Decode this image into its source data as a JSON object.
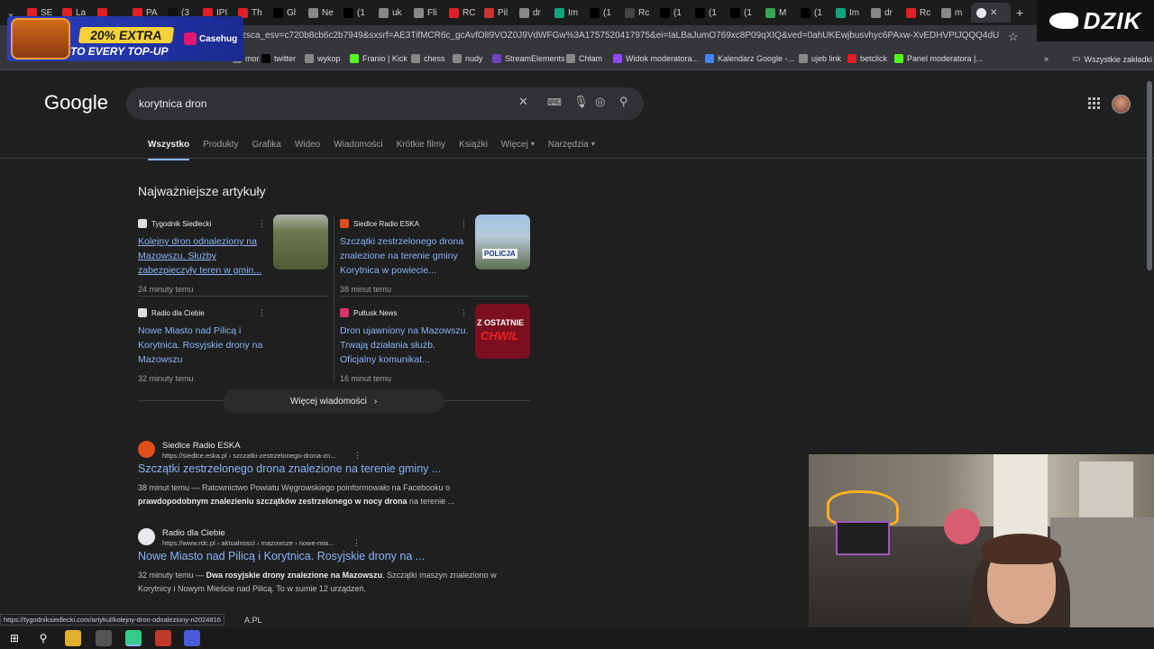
{
  "browser": {
    "tabs": [
      {
        "label": "SE",
        "color": "#e21f26"
      },
      {
        "label": "La",
        "color": "#e21f26"
      },
      {
        "label": "",
        "color": "#e21f26"
      },
      {
        "label": "PA",
        "color": "#e21f26"
      },
      {
        "label": "(3",
        "color": "#111111"
      },
      {
        "label": "IPI",
        "color": "#e21f26"
      },
      {
        "label": "Th",
        "color": "#e21f26"
      },
      {
        "label": "Gl",
        "color": "#000000"
      },
      {
        "label": "Ne",
        "color": "#888888"
      },
      {
        "label": "(1",
        "color": "#000000"
      },
      {
        "label": "uk",
        "color": "#888888"
      },
      {
        "label": "Fli",
        "color": "#888888"
      },
      {
        "label": "RC",
        "color": "#e21f26"
      },
      {
        "label": "Pil",
        "color": "#cc3333"
      },
      {
        "label": "dr",
        "color": "#888888"
      },
      {
        "label": "Im",
        "color": "#10a37f"
      },
      {
        "label": "(1",
        "color": "#000000"
      },
      {
        "label": "Rc",
        "color": "#444444"
      },
      {
        "label": "(1",
        "color": "#000000"
      },
      {
        "label": "(1",
        "color": "#000000"
      },
      {
        "label": "(1",
        "color": "#000000"
      },
      {
        "label": "M",
        "color": "#34a853"
      },
      {
        "label": "(1",
        "color": "#000000"
      },
      {
        "label": "Im",
        "color": "#10a37f"
      },
      {
        "label": "dr",
        "color": "#888888"
      },
      {
        "label": "Rc",
        "color": "#e21f26"
      },
      {
        "label": "m",
        "color": "#888888"
      }
    ],
    "active_tab_index": 27,
    "url": "zsca_esv=c720b8cb6c2b7949&sxsrf=AE3TifMCR6c_gcAvfOlI9VOZ0J9VdWFGw%3A1757520417975&ei=IaLBaJumO769xc8P09qXIQ&ved=0ahUKEwjbusvhyc6PAxw-XvEDHVPtJQQQ4dUDCBA&uact=5&oq...",
    "bookmarks": [
      {
        "label": "mor",
        "color": "#888888"
      },
      {
        "label": "twitter",
        "color": "#000000"
      },
      {
        "label": "wykop",
        "color": "#888888"
      },
      {
        "label": "Franio | Kick",
        "color": "#53fc18"
      },
      {
        "label": "chess",
        "color": "#888888"
      },
      {
        "label": "nudy",
        "color": "#888888"
      },
      {
        "label": "StreamElements",
        "color": "#6f42c1"
      },
      {
        "label": "Chłam",
        "color": "#888888"
      },
      {
        "label": "Widok moderatora...",
        "color": "#9146ff"
      },
      {
        "label": "Kalendarz Google -...",
        "color": "#4285f4"
      },
      {
        "label": "ujeb link",
        "color": "#888888"
      },
      {
        "label": "betclick",
        "color": "#e21f26"
      },
      {
        "label": "Panel moderatora |...",
        "color": "#53fc18"
      }
    ],
    "bookmarks_more": "»",
    "all_bookmarks": "Wszystkie zakładki"
  },
  "overlay": {
    "promo_line1": "20% EXTRA",
    "promo_line2": "TO EVERY TOP-UP",
    "promo_brand": "Casehug",
    "dzik_logo": "DZIK"
  },
  "google": {
    "logo": "Google",
    "query": "korytnica dron",
    "tabs": [
      "Wszystko",
      "Produkty",
      "Grafika",
      "Wideo",
      "Wiadomości",
      "Krótkie filmy",
      "Książki",
      "Więcej",
      "Narzędzia"
    ],
    "active_tab": "Wszystko",
    "top_stories_heading": "Najważniejsze artykuły",
    "top_stories": [
      {
        "source": "Tygodnik Siedlecki",
        "title": "Kolejny dron odnaleziony na Mazowszu. Służby zabezpieczyły teren w gmin...",
        "time": "24 minuty temu",
        "fav_color": "#dddddd",
        "thumb": "field"
      },
      {
        "source": "Siedlce Radio ESKA",
        "title": "Szczątki zestrzelonego drona znalezione na terenie gminy Korytnica w powiecie...",
        "time": "38 minut temu",
        "fav_color": "#e04e1c",
        "thumb": "police"
      },
      {
        "source": "Radio dla Ciebie",
        "title": "Nowe Miasto nad Pilicą i Korytnica. Rosyjskie drony na Mazowszu",
        "time": "32 minuty temu",
        "fav_color": "#dddddd",
        "thumb": ""
      },
      {
        "source": "Pułtusk News",
        "title": "Dron ujawniony na Mazowszu. Trwają działania służb. Oficjalny komunikat...",
        "time": "16 minut temu",
        "fav_color": "#d6336c",
        "thumb": "news"
      }
    ],
    "thumb_texts": {
      "police": "POLICJA",
      "news_1": "Z OSTATNIE",
      "news_2": "CHWIL"
    },
    "more_news": "Więcej wiadomości",
    "results": [
      {
        "site": "Siedlce Radio ESKA",
        "cite": "https://siedlce.eska.pl › szczatki-zestrzelonego-drona-zn...",
        "title": "Szczątki zestrzelonego drona znalezione na terenie gminy ...",
        "snippet_pre": "38 minut temu — Ratownictwo Powiatu Węgrowskiego poinformowało na Facebooku o ",
        "snippet_bold": "prawdopodobnym znalezieniu szczątków zestrzelonego w nocy drona",
        "snippet_post": " na terenie ..."
      },
      {
        "site": "Radio dla Ciebie",
        "cite": "https://www.rdc.pl › aktualnosci › mazowsze › nowe-mia...",
        "title": "Nowe Miasto nad Pilicą i Korytnica. Rosyjskie drony na ...",
        "snippet_pre": "32 minuty temu — ",
        "snippet_bold": "Dwa rosyjskie drony znalezione na Mazowszu",
        "snippet_post": ". Szczątki maszyn znaleziono w Korytnicy i Nowym Mieście nad Pilicą. To w sumie 12 urządzeń."
      }
    ]
  },
  "status_bar": {
    "link": "https://tygodniksiedlecki.com/artykul/kolejny-dron-odnaleziony-n2024816",
    "extra": "A.PL"
  },
  "taskbar": {
    "items": [
      "windows-start",
      "search",
      "file-explorer",
      "app",
      "chrome",
      "app-red",
      "app-chrome"
    ]
  }
}
